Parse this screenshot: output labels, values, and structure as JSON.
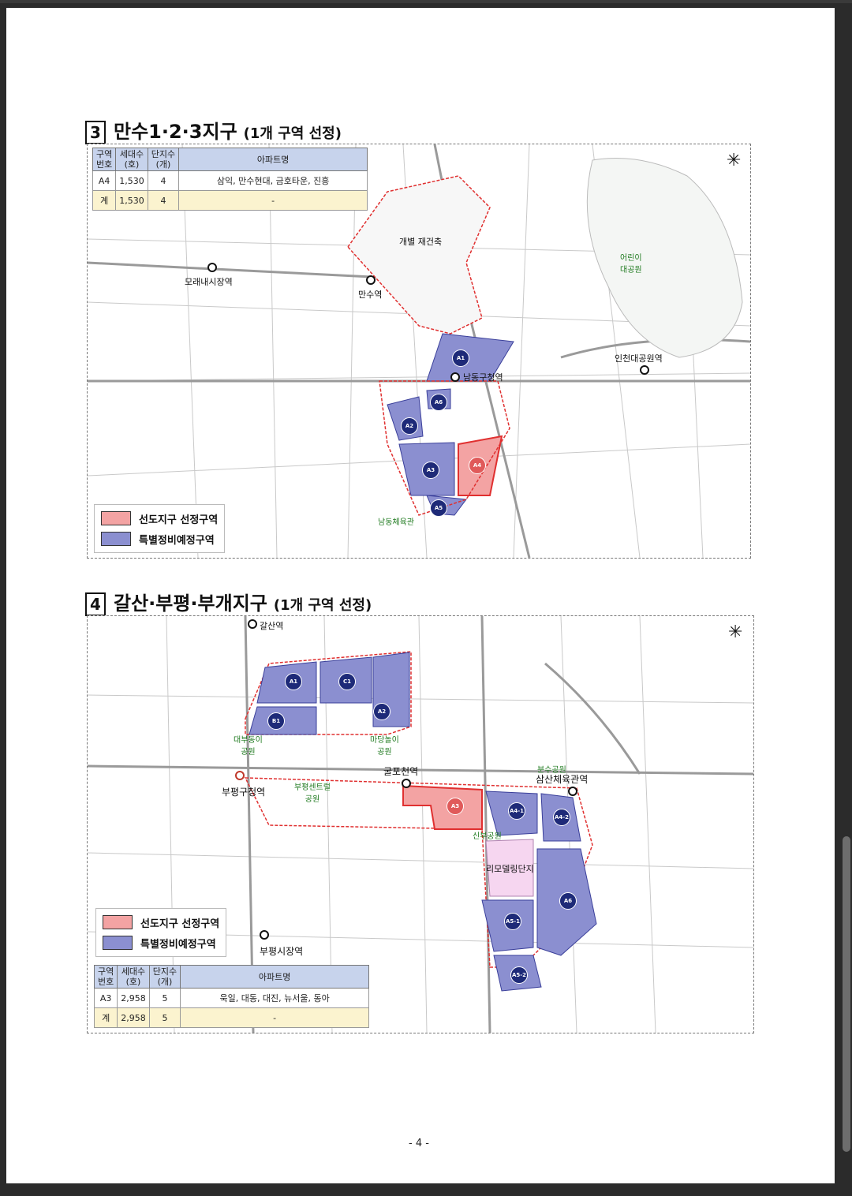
{
  "section3": {
    "number": "3",
    "title": "만수1·2·3지구",
    "subtitle": "(1개 구역 선정)",
    "table": {
      "headers": [
        "구역\n번호",
        "세대수\n(호)",
        "단지수\n(개)",
        "아파트명"
      ],
      "rows": [
        {
          "zone": "A4",
          "households": "1,530",
          "complexes": "4",
          "names": "삼익, 만수현대, 금호타운, 진흥"
        }
      ],
      "total": {
        "zone": "계",
        "households": "1,530",
        "complexes": "4",
        "names": "-"
      }
    },
    "labels": {
      "redevelop": "개별 재건축",
      "forest": "어린이\n대공원",
      "station_morae": "모래내시장역",
      "station_mansu": "만수역",
      "station_namdong": "남동구청역",
      "station_incheon_park": "인천대공원역",
      "namdong_gym": "남동체육관"
    },
    "badges": [
      "A1",
      "A6",
      "A2",
      "A3",
      "A4",
      "A5"
    ],
    "legend": {
      "selected": "선도지구 선정구역",
      "special": "특별정비예정구역"
    }
  },
  "section4": {
    "number": "4",
    "title": "갈산·부평·부개지구",
    "subtitle": "(1개 구역 선정)",
    "table": {
      "headers": [
        "구역\n번호",
        "세대수\n(호)",
        "단지수\n(개)",
        "아파트명"
      ],
      "rows": [
        {
          "zone": "A3",
          "households": "2,958",
          "complexes": "5",
          "names": "욱일, 대동, 대진, 뉴서울, 동아"
        }
      ],
      "total": {
        "zone": "계",
        "households": "2,958",
        "complexes": "5",
        "names": "-"
      }
    },
    "labels": {
      "station_galsan": "갈산역",
      "station_bupyeong_gu": "부평구청역",
      "station_gulpocheon": "굴포천역",
      "station_samsan": "삼산체육관역",
      "station_bupyeong_market": "부평시장역",
      "park_daebu": "대부동이\n공원",
      "park_hiddensoop": "마당놀이\n공원",
      "park_central": "부평센트럴\n공원",
      "park_bunsu": "분수공원",
      "park_sinbu": "신부공원",
      "remodel": "리모델링단지"
    },
    "badges": [
      "A1",
      "C1",
      "B1",
      "A2",
      "A3",
      "A4-1",
      "A4-2",
      "A6",
      "A5-1",
      "A5-2"
    ],
    "legend": {
      "selected": "선도지구 선정구역",
      "special": "특별정비예정구역"
    }
  },
  "colors": {
    "selected_fill": "#f3a3a3",
    "selected_border": "#e03030",
    "special_fill": "#8b8fd0",
    "special_border": "#3a3f9a",
    "table_header": "#c7d3ec",
    "table_total": "#fbf3cf"
  },
  "page_number": "- 4 -"
}
